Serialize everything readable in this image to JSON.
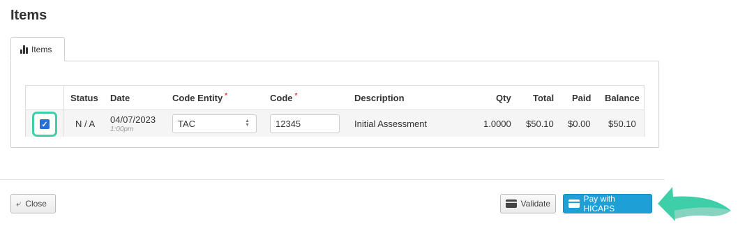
{
  "page": {
    "title": "Items"
  },
  "tabs": [
    {
      "label": "Items",
      "icon": "bar-chart-icon"
    }
  ],
  "table": {
    "columns": {
      "status": "Status",
      "date": "Date",
      "code_entity": "Code Entity",
      "code": "Code",
      "description": "Description",
      "qty": "Qty",
      "total": "Total",
      "paid": "Paid",
      "balance": "Balance",
      "required_marker": "*"
    },
    "rows": [
      {
        "checked": true,
        "status": "N / A",
        "date": "04/07/2023",
        "time": "1:00pm",
        "code_entity": "TAC",
        "code": "12345",
        "description": "Initial Assessment",
        "qty": "1.0000",
        "total": "$50.10",
        "paid": "$0.00",
        "balance": "$50.10"
      }
    ]
  },
  "footer": {
    "close_label": "Close",
    "validate_label": "Validate",
    "pay_label": "Pay with HICAPS"
  },
  "colors": {
    "highlight": "#3ecfa8",
    "primary_button": "#1e9fd6",
    "checkbox": "#2a6ed8",
    "required": "#e03a3a"
  }
}
